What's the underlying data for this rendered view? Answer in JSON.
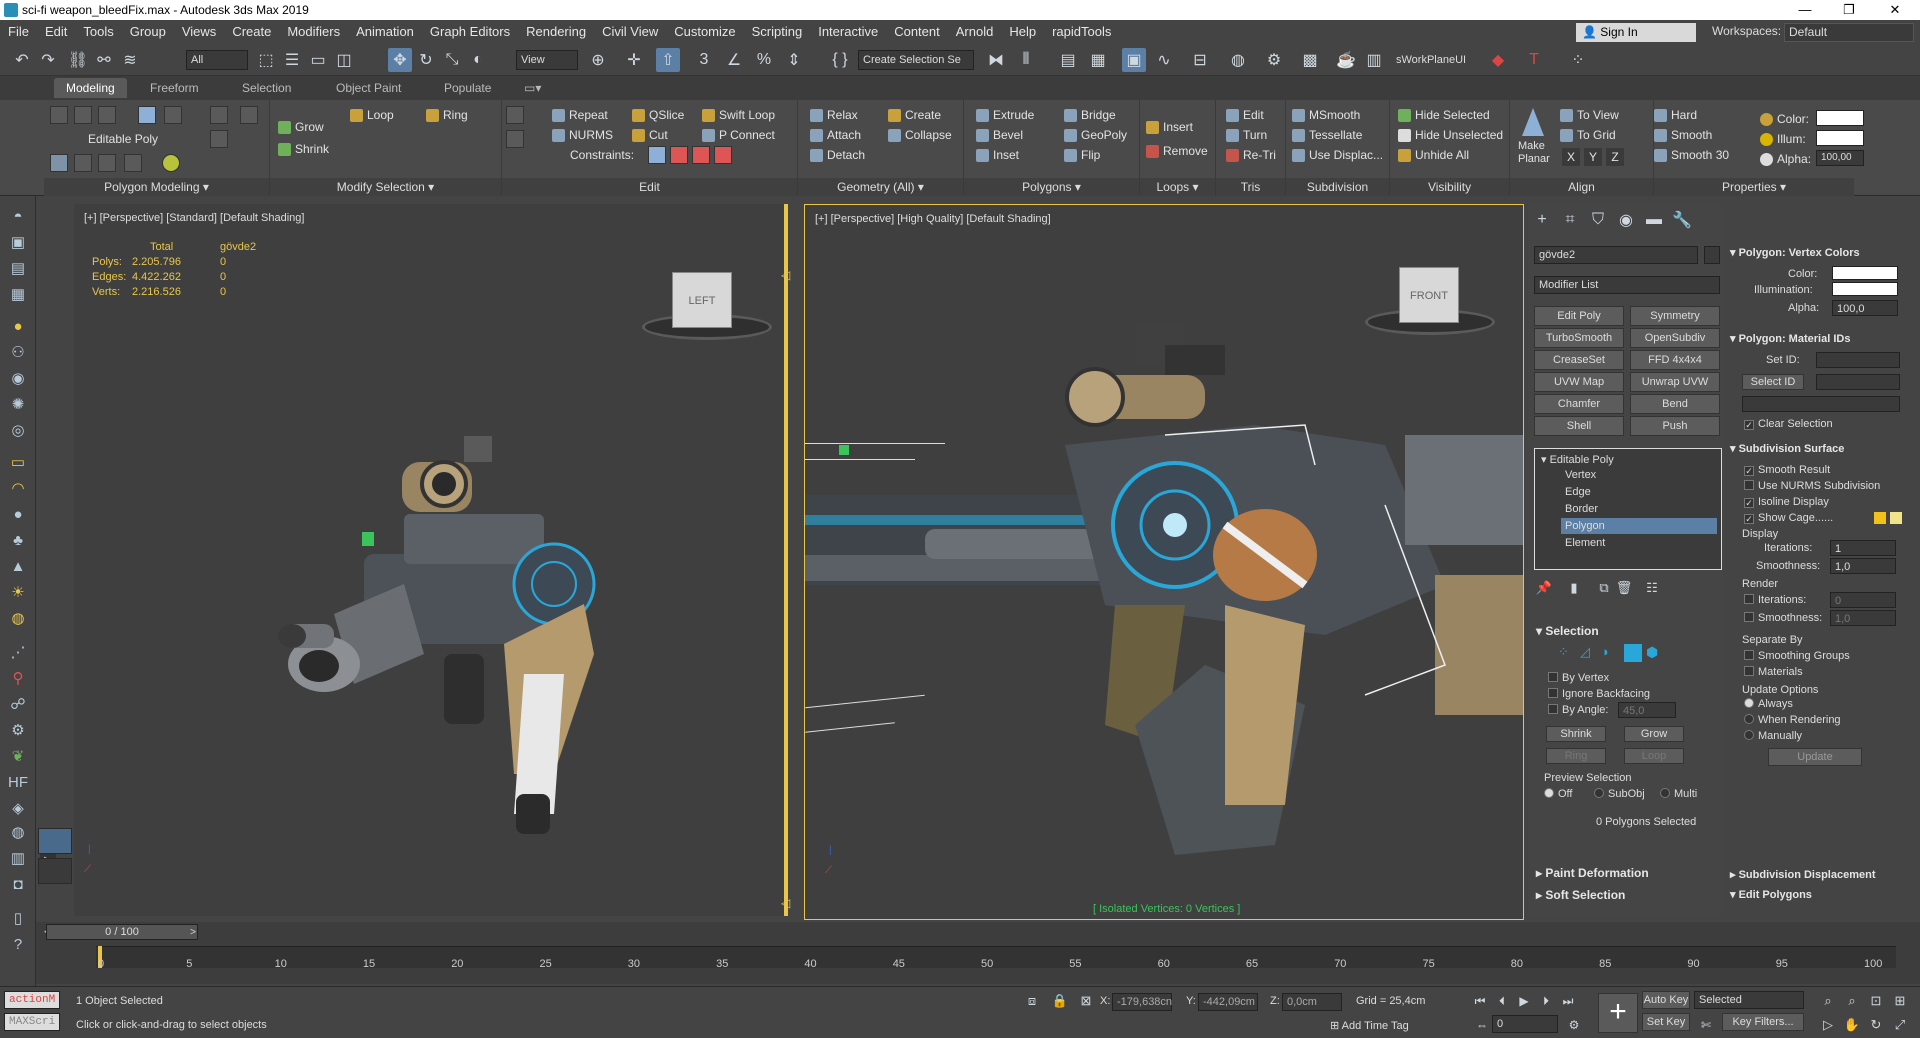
{
  "window": {
    "title": "sci-fi weapon_bleedFix.max - Autodesk 3ds Max 2019",
    "minimize": "—",
    "maximize": "❐",
    "close": "✕"
  },
  "menu": [
    "File",
    "Edit",
    "Tools",
    "Group",
    "Views",
    "Create",
    "Modifiers",
    "Animation",
    "Graph Editors",
    "Rendering",
    "Civil View",
    "Customize",
    "Scripting",
    "Interactive",
    "Content",
    "Arnold",
    "Help",
    "rapidTools"
  ],
  "account": {
    "signin": "Sign In",
    "workspaces_label": "Workspaces:",
    "workspace": "Default"
  },
  "toolbar": {
    "filter": "All",
    "ref_coord": "View",
    "selection_set": "Create Selection Se",
    "workplane": "sWorkPlaneUI"
  },
  "ribbon_tabs": [
    "Modeling",
    "Freeform",
    "Selection",
    "Object Paint",
    "Populate"
  ],
  "ribbon": {
    "polygon_modeling": {
      "label": "Editable Poly",
      "footer": "Polygon Modeling ▾"
    },
    "modify_selection": {
      "grow": "Grow",
      "shrink": "Shrink",
      "loop": "Loop",
      "ring": "Ring",
      "footer": "Modify Selection ▾"
    },
    "edit": {
      "repeat": "Repeat",
      "qslice": "QSlice",
      "swift_loop": "Swift Loop",
      "nurms": "NURMS",
      "cut": "Cut",
      "p_connect": "P Connect",
      "constraints": "Constraints:",
      "footer": "Edit"
    },
    "geometry": {
      "relax": "Relax",
      "create": "Create",
      "attach": "Attach",
      "collapse": "Collapse",
      "detach": "Detach",
      "footer": "Geometry (All) ▾"
    },
    "polygons": {
      "extrude": "Extrude",
      "bridge": "Bridge",
      "bevel": "Bevel",
      "geopoly": "GeoPoly",
      "inset": "Inset",
      "flip": "Flip",
      "footer": "Polygons ▾"
    },
    "loops": {
      "insert": "Insert",
      "remove": "Remove",
      "footer": "Loops ▾"
    },
    "tris": {
      "edit": "Edit",
      "turn": "Turn",
      "retri": "Re-Tri",
      "footer": "Tris"
    },
    "subdivision": {
      "msmooth": "MSmooth",
      "tessellate": "Tessellate",
      "use_displac": "Use Displac...",
      "footer": "Subdivision"
    },
    "visibility": {
      "hide_selected": "Hide Selected",
      "hide_unselected": "Hide Unselected",
      "unhide_all": "Unhide All",
      "footer": "Visibility"
    },
    "align": {
      "make_planar": "Make Planar",
      "to_view": "To View",
      "to_grid": "To Grid",
      "x": "X",
      "y": "Y",
      "z": "Z",
      "footer": "Align"
    },
    "properties": {
      "hard": "Hard",
      "smooth": "Smooth",
      "smooth30": "Smooth 30",
      "color": "Color:",
      "illum": "Illum:",
      "alpha": "Alpha:",
      "alpha_val": "100,00",
      "footer": "Properties ▾"
    }
  },
  "viewport_left": {
    "label": "[+] [Perspective] [Standard] [Default Shading]",
    "stats": {
      "h1": "Total",
      "h2": "gövde2",
      "rows": [
        [
          "Polys:",
          "2.205.796",
          "0"
        ],
        [
          "Edges:",
          "4.422.262",
          "0"
        ],
        [
          "Verts:",
          "2.216.526",
          "0"
        ]
      ]
    },
    "cube": "LEFT"
  },
  "viewport_right": {
    "label": "[+] [Perspective] [High Quality] [Default Shading]",
    "cube": "FRONT",
    "isolated": "[ Isolated Vertices: 0 Vertices ]"
  },
  "command_panel": {
    "object_name": "gövde2",
    "modifier_list": "Modifier List",
    "mod_buttons": [
      "Edit Poly",
      "Symmetry",
      "TurboSmooth",
      "OpenSubdiv",
      "CreaseSet",
      "FFD 4x4x4",
      "UVW Map",
      "Unwrap UVW",
      "Chamfer",
      "Bend",
      "Shell",
      "Push"
    ],
    "stack": [
      "Editable Poly",
      "Vertex",
      "Edge",
      "Border",
      "Polygon",
      "Element"
    ],
    "selection": {
      "header": "Selection",
      "by_vertex": "By Vertex",
      "ignore_backfacing": "Ignore Backfacing",
      "by_angle": "By Angle:",
      "angle": "45,0",
      "shrink": "Shrink",
      "grow": "Grow",
      "ring": "Ring",
      "loop": "Loop",
      "preview": "Preview Selection",
      "off": "Off",
      "subobj": "SubObj",
      "multi": "Multi",
      "count": "0 Polygons Selected"
    },
    "paint_deformation": "Paint Deformation",
    "soft_selection": "Soft Selection"
  },
  "right_panel": {
    "vertex_colors": {
      "header": "Polygon: Vertex Colors",
      "color": "Color:",
      "illum": "Illumination:",
      "alpha": "Alpha:",
      "alpha_val": "100,0"
    },
    "material_ids": {
      "header": "Polygon: Material IDs",
      "set_id": "Set ID:",
      "select_id": "Select ID",
      "clear": "Clear Selection"
    },
    "subdivision_surface": {
      "header": "Subdivision Surface",
      "smooth_result": "Smooth Result",
      "use_nurms": "Use NURMS Subdivision",
      "isoline": "Isoline Display",
      "show_cage": "Show Cage......",
      "display": "Display",
      "iterations": "Iterations:",
      "iter_val": "1",
      "smoothness": "Smoothness:",
      "smooth_val": "1,0",
      "render": "Render",
      "r_iter_val": "0",
      "r_smooth_val": "1,0",
      "separate_by": "Separate By",
      "smoothing_groups": "Smoothing Groups",
      "materials": "Materials",
      "update_options": "Update Options",
      "always": "Always",
      "when_rendering": "When Rendering",
      "manually": "Manually",
      "update": "Update"
    },
    "subdivision_displacement": "Subdivision Displacement",
    "edit_polygons": "Edit Polygons"
  },
  "timeline": {
    "frame": "0 / 100",
    "ticks": [
      "0",
      "5",
      "10",
      "15",
      "20",
      "25",
      "30",
      "35",
      "40",
      "45",
      "50",
      "55",
      "60",
      "65",
      "70",
      "75",
      "80",
      "85",
      "90",
      "95",
      "100"
    ]
  },
  "status": {
    "script1": "actionM",
    "script2": "MAXScri",
    "selected": "1 Object Selected",
    "prompt": "Click or click-and-drag to select objects",
    "x_label": "X:",
    "x": "-179,638cn",
    "y_label": "Y:",
    "y": "-442,09cm",
    "z_label": "Z:",
    "z": "0,0cm",
    "grid": "Grid = 25,4cm",
    "add_time_tag": "Add Time Tag",
    "auto_key": "Auto Key",
    "set_key": "Set Key",
    "selected_mode": "Selected",
    "key_filters": "Key Filters...",
    "frame_field": "0"
  }
}
